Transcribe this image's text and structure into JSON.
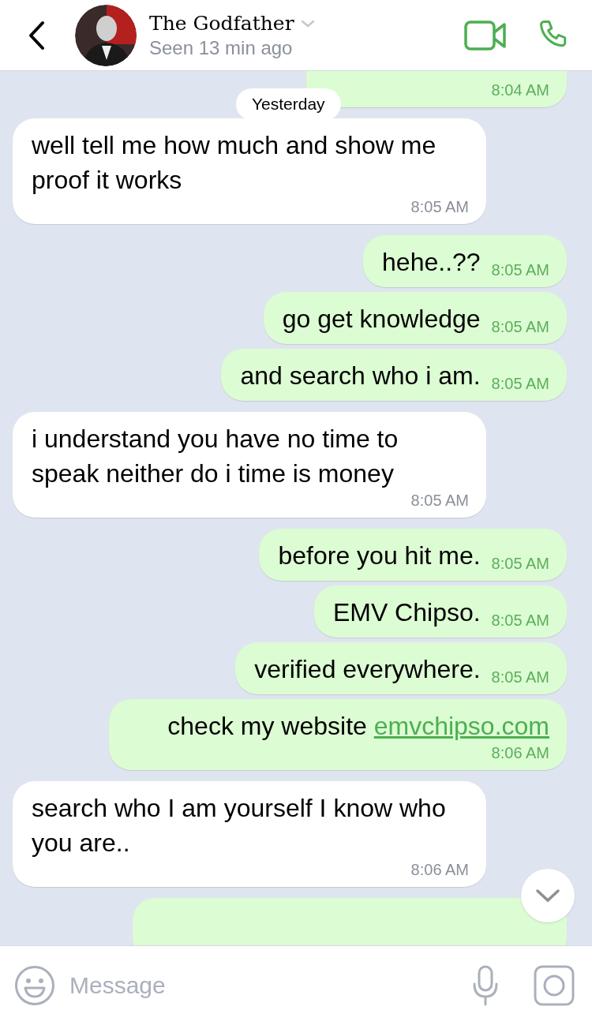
{
  "header": {
    "contact_name": "The Godfather",
    "status": "Seen 13 min ago"
  },
  "date_label": "Yesterday",
  "messages": [
    {
      "kind": "outgoing",
      "time": "8:04 AM"
    },
    {
      "kind": "incoming",
      "text": "well tell me how much and show me proof it works",
      "time": "8:05 AM"
    },
    {
      "kind": "outgoing",
      "text": "hehe..??",
      "time": "8:05 AM"
    },
    {
      "kind": "outgoing",
      "text": "go get knowledge",
      "time": "8:05 AM"
    },
    {
      "kind": "outgoing",
      "text": "and search who i am.",
      "time": "8:05 AM"
    },
    {
      "kind": "incoming",
      "text": "i understand you have no time to speak neither do i time is money",
      "time": "8:05 AM"
    },
    {
      "kind": "outgoing",
      "text": "before you hit me.",
      "time": "8:05 AM"
    },
    {
      "kind": "outgoing",
      "text": "EMV Chipso.",
      "time": "8:05 AM"
    },
    {
      "kind": "outgoing",
      "text": "verified everywhere.",
      "time": "8:05 AM"
    },
    {
      "kind": "outgoing",
      "text": "check my website ",
      "link": "emvchipso.com",
      "time": "8:06 AM"
    },
    {
      "kind": "incoming",
      "text": "search who I am yourself I know who you are..",
      "time": "8:06 AM"
    },
    {
      "kind": "outgoing"
    }
  ],
  "composer": {
    "placeholder": "Message"
  }
}
